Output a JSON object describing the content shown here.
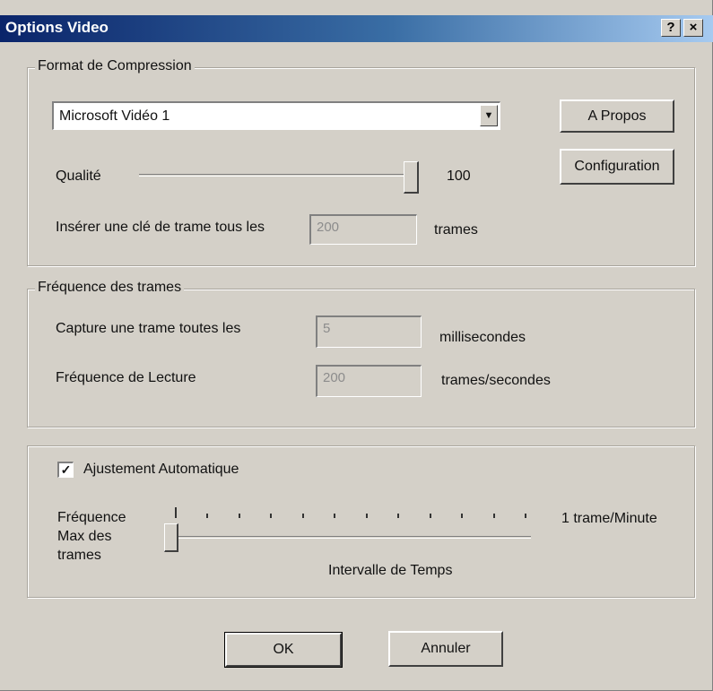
{
  "window": {
    "title": "Options Video",
    "help_glyph": "?",
    "close_glyph": "×"
  },
  "compression": {
    "group_label": "Format de Compression",
    "codec": "Microsoft Vidéo 1",
    "combo_arrow": "▼",
    "about_label": "A Propos",
    "config_label": "Configuration",
    "quality_label": "Qualité",
    "quality_value": "100",
    "quality_level": 1.0,
    "keyframe_label": "Insérer une clé de trame tous les",
    "keyframe_value": "200",
    "keyframe_unit": "trames"
  },
  "framerate": {
    "group_label": "Fréquence des trames",
    "capture_label": "Capture une trame toutes les",
    "capture_value": "5",
    "capture_unit": "millisecondes",
    "playback_label": "Fréquence de Lecture",
    "playback_value": "200",
    "playback_unit": "trames/secondes"
  },
  "auto": {
    "checkbox_label": "Ajustement Automatique",
    "checked": true,
    "check_glyph": "✓",
    "max_label_1": "Fréquence",
    "max_label_2": "Max des",
    "max_label_3": "trames",
    "slider_end_label": "1 trame/Minute",
    "slider_caption": "Intervalle de Temps",
    "slider_level": 0.0
  },
  "buttons": {
    "ok": "OK",
    "cancel": "Annuler"
  }
}
